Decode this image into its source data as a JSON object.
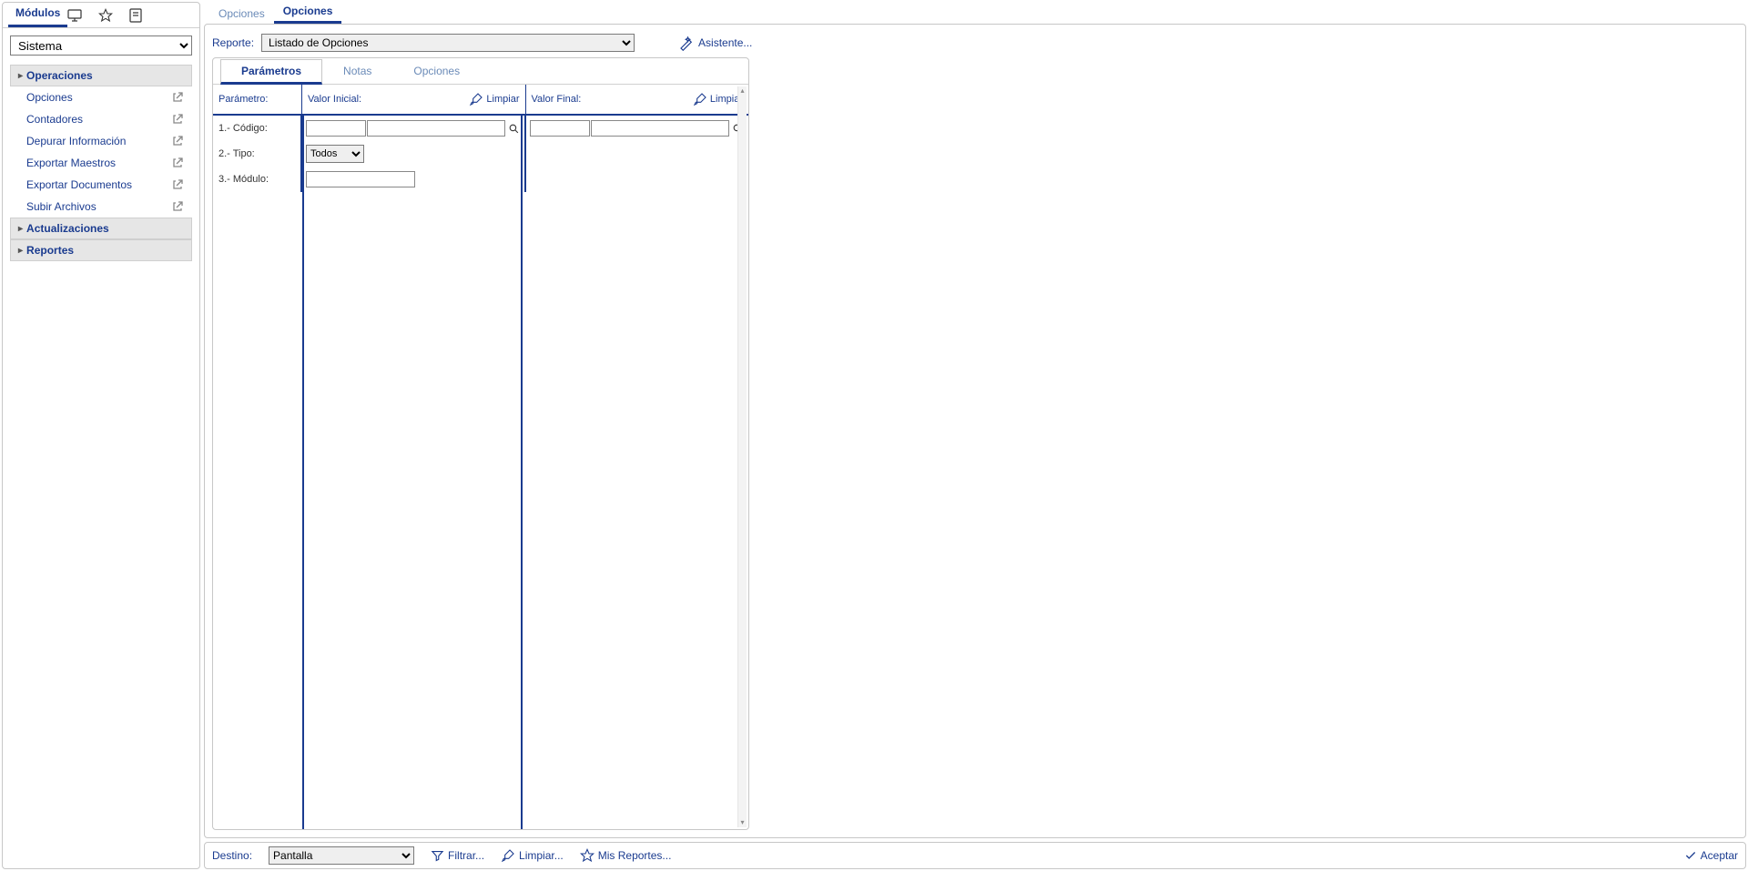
{
  "sidebar": {
    "tabs": {
      "modulos": "Módulos"
    },
    "select_value": "Sistema",
    "groups": {
      "operaciones": "Operaciones",
      "actualizaciones": "Actualizaciones",
      "reportes": "Reportes"
    },
    "items": [
      {
        "label": "Opciones"
      },
      {
        "label": "Contadores"
      },
      {
        "label": "Depurar Información"
      },
      {
        "label": "Exportar Maestros"
      },
      {
        "label": "Exportar Documentos"
      },
      {
        "label": "Subir Archivos"
      }
    ]
  },
  "top_tabs": {
    "opciones1": "Opciones",
    "opciones2": "Opciones"
  },
  "report": {
    "label": "Reporte:",
    "value": "Listado de Opciones",
    "assistente": "Asistente..."
  },
  "panel_tabs": {
    "param": "Parámetros",
    "notas": "Notas",
    "opciones": "Opciones"
  },
  "headers": {
    "parametro": "Parámetro:",
    "valor_inicial": "Valor Inicial:",
    "valor_final": "Valor Final:",
    "limpiar": "Limpiar"
  },
  "rows": {
    "codigo": "1.- Código:",
    "tipo": "2.- Tipo:",
    "modulo": "3.- Módulo:",
    "tipo_value": "Todos"
  },
  "footer": {
    "destino_label": "Destino:",
    "destino_value": "Pantalla",
    "filtrar": "Filtrar...",
    "limpiar": "Limpiar...",
    "mis_reportes": "Mis Reportes...",
    "aceptar": "Aceptar"
  }
}
